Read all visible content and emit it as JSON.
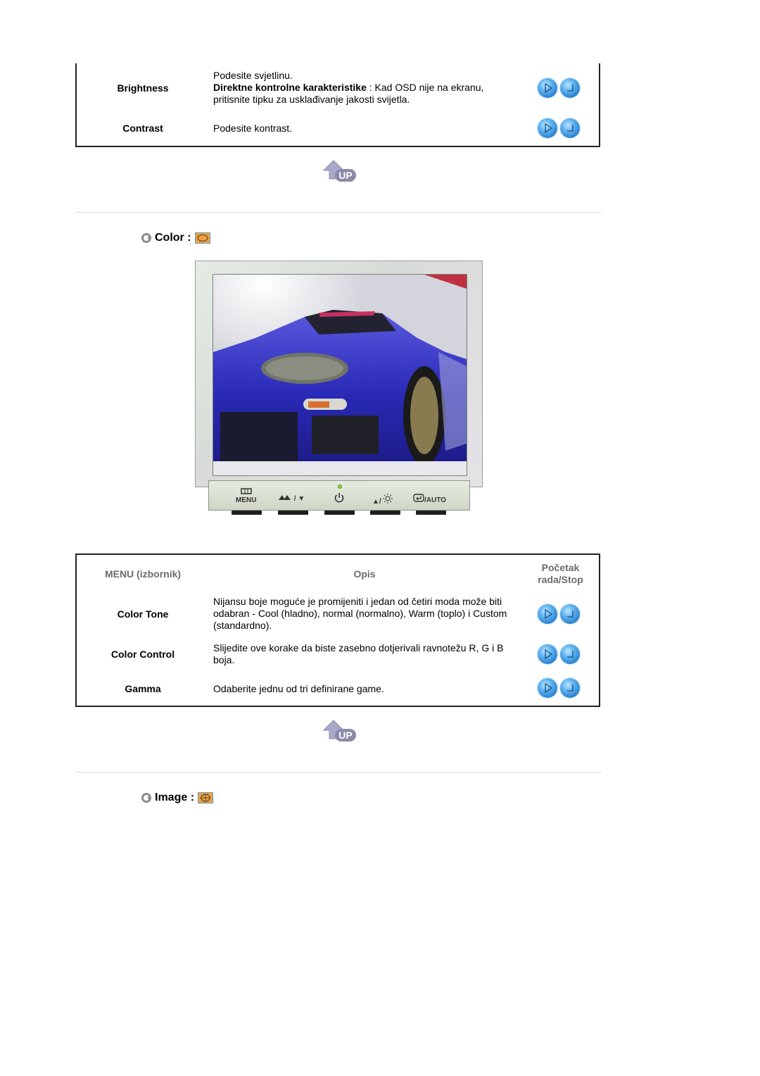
{
  "picture_table": {
    "rows": [
      {
        "name": "Brightness",
        "desc_line1": "Podesite svjetlinu.",
        "desc_bold": "Direktne kontrolne karakteristike",
        "desc_rest": " : Kad OSD nije na ekranu, pritisnite tipku za usklađivanje jakosti svijetla.",
        "play_icon": "play-orb-icon",
        "stop_icon": "stop-orb-icon"
      },
      {
        "name": "Contrast",
        "desc": "Podesite kontrast.",
        "play_icon": "play-orb-icon",
        "stop_icon": "stop-orb-icon"
      }
    ]
  },
  "up_link": {
    "label": "UP",
    "icon": "up-arrow-icon"
  },
  "color_section": {
    "title": "Color :",
    "icon": "color-osd-icon",
    "monitor": {
      "buttons": [
        {
          "label": "MENU",
          "icon": "menu-icon"
        },
        {
          "label": "/ ▼",
          "icon": "magicbright-icon"
        },
        {
          "label": "",
          "icon": "power-icon"
        },
        {
          "label": "▲/",
          "icon": "brightness-icon"
        },
        {
          "label": "/AUTO",
          "icon": "enter-icon"
        }
      ],
      "power_led_color": "#8ed23a"
    },
    "table": {
      "headers": {
        "menu": "MENU (izbornik)",
        "desc": "Opis",
        "action": "Početak rada/Stop"
      },
      "rows": [
        {
          "name": "Color Tone",
          "desc": "Nijansu boje moguće je promijeniti i jedan od četiri moda može biti odabran - Cool (hladno), normal (normalno), Warm (toplo) i Custom (standardno)."
        },
        {
          "name": "Color Control",
          "desc": "Slijedite ove korake da biste zasebno dotjerivali ravnotežu R, G i B boja."
        },
        {
          "name": "Gamma",
          "desc": "Odaberite jednu od tri definirane game."
        }
      ]
    }
  },
  "image_section": {
    "title": "Image :",
    "icon": "image-osd-icon"
  },
  "colors": {
    "orb_blue": "#2a7fd0",
    "header_gray": "#6b6b6b",
    "osd_orange": "#f0a040"
  }
}
